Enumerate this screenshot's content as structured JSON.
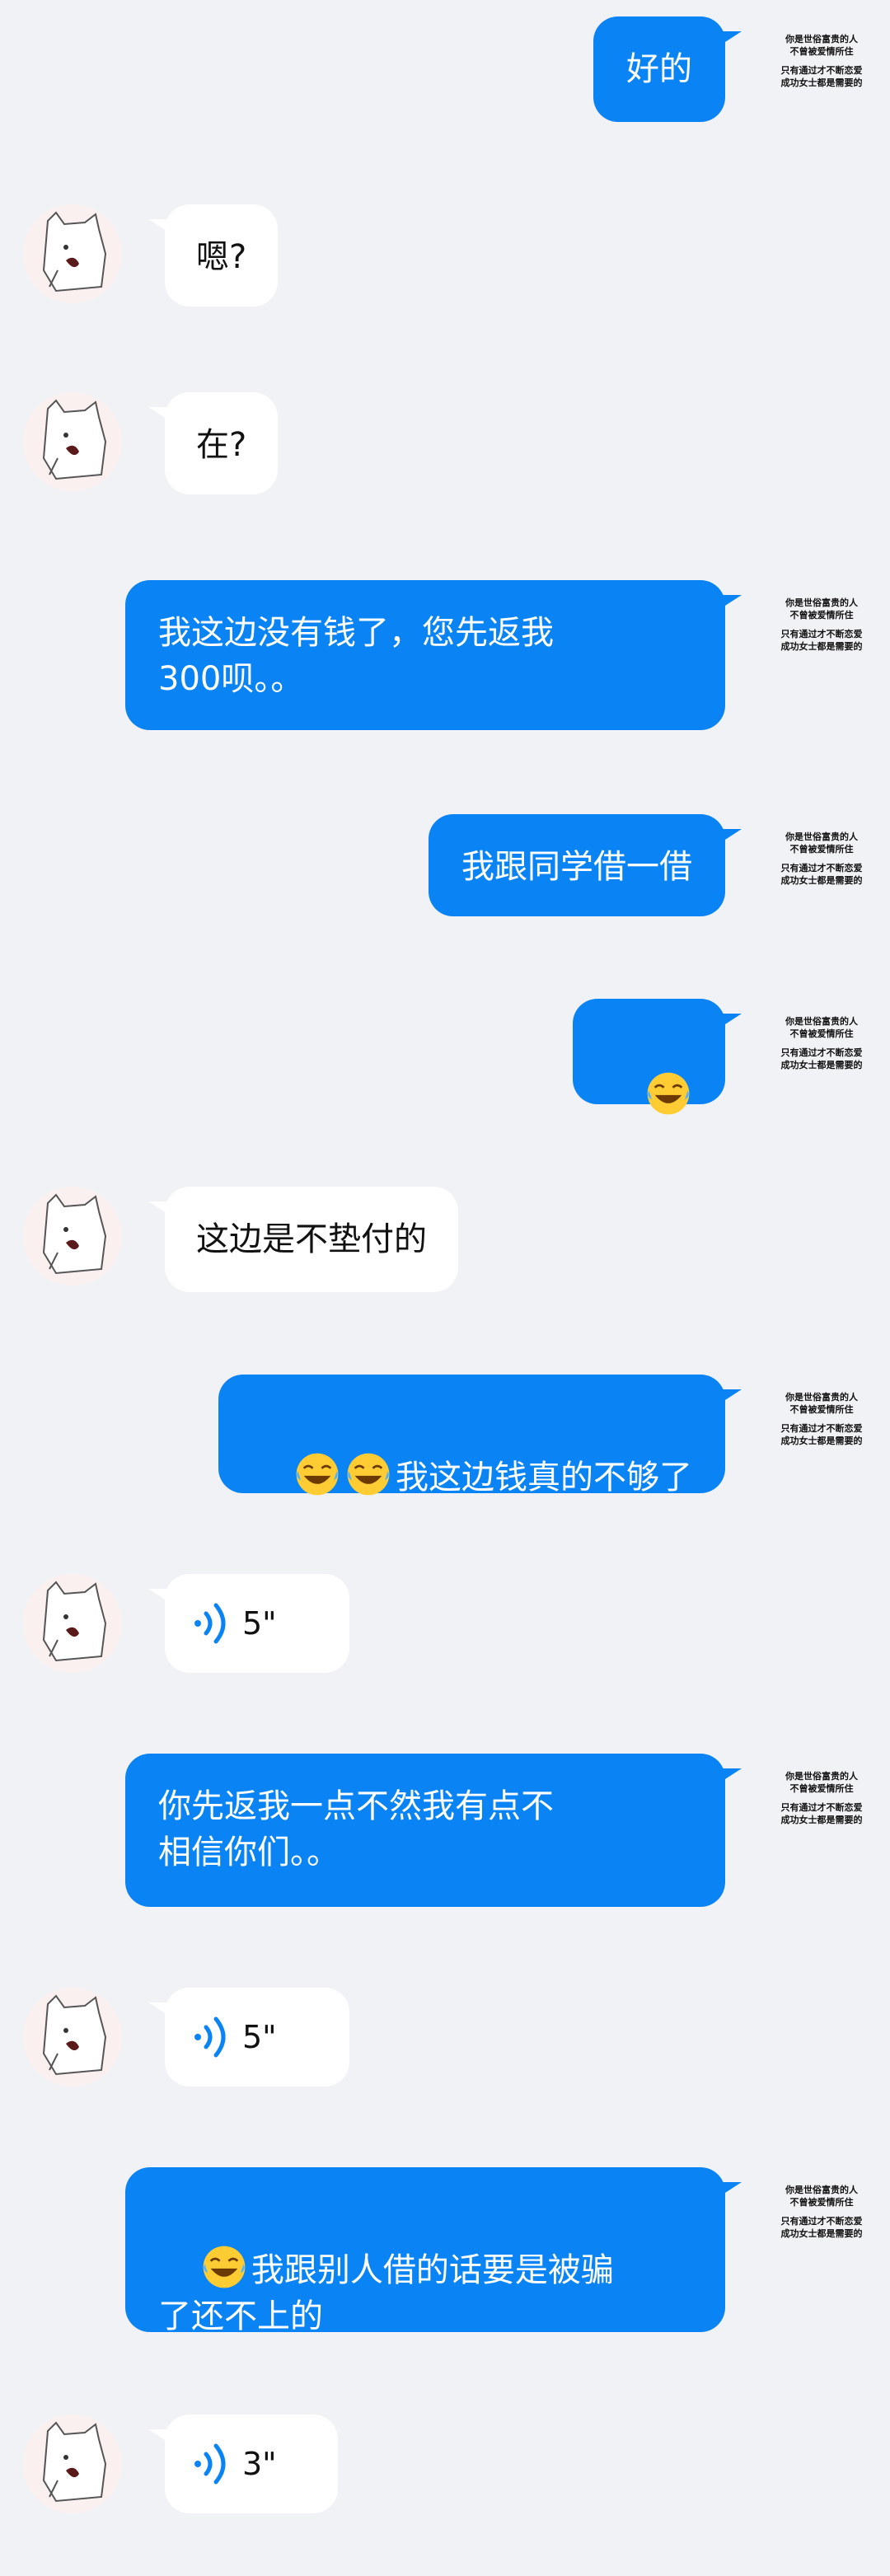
{
  "side_tag": {
    "line1": "你是世俗富贵的人",
    "line2": "不曾被爱情所住",
    "line3": "只有通过才不断恋爱",
    "line4": "成功女士都是需要的"
  },
  "messages": [
    {
      "dir": "out",
      "text": "好的"
    },
    {
      "dir": "in",
      "text": "嗯?"
    },
    {
      "dir": "in",
      "text": "在?"
    },
    {
      "dir": "out",
      "text": "我这边没有钱了，您先返我\n300呗。。"
    },
    {
      "dir": "out",
      "text": "我跟同学借一借"
    },
    {
      "dir": "out",
      "emoji_count": 1,
      "text": ""
    },
    {
      "dir": "in",
      "text": "这边是不垫付的"
    },
    {
      "dir": "out",
      "emoji_count": 2,
      "text": "我这边钱真的不够了"
    },
    {
      "dir": "in",
      "voice": "5\""
    },
    {
      "dir": "out",
      "text": "你先返我一点不然我有点不\n相信你们。。"
    },
    {
      "dir": "in",
      "voice": "5\""
    },
    {
      "dir": "out",
      "emoji_count": 1,
      "text": "我跟别人借的话要是被骗\n了还不上的"
    },
    {
      "dir": "in",
      "voice": "3\""
    }
  ]
}
